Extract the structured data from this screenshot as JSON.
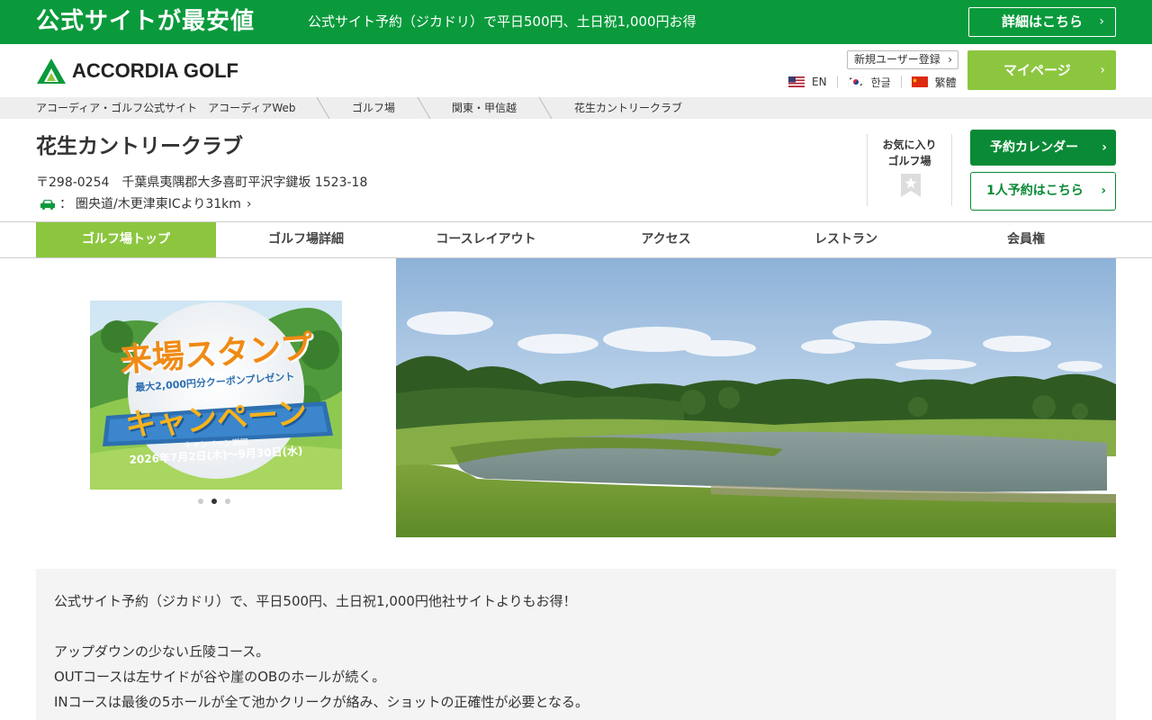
{
  "promo": {
    "title": "公式サイトが最安値",
    "text": "公式サイト予約（ジカドリ）で平日500円、土日祝1,000円お得",
    "detail_button": "詳細はこちら"
  },
  "header": {
    "logo_text": "ACCORDIA GOLF",
    "register_button": "新規ユーザー登録",
    "mypage_button": "マイページ",
    "languages": [
      {
        "label": "EN",
        "flag": "us-flag-icon"
      },
      {
        "label": "한글",
        "flag": "kr-flag-icon"
      },
      {
        "label": "繁體",
        "flag": "cn-flag-icon"
      }
    ]
  },
  "breadcrumb": [
    "アコーディア・ゴルフ公式サイト　アコーディアWeb",
    "ゴルフ場",
    "関東・甲信越",
    "花生カントリークラブ"
  ],
  "club": {
    "name": "花生カントリークラブ",
    "address": "〒298-0254　千葉県夷隅郡大多喜町平沢字鍵坂 1523-18",
    "access_prefix": "：",
    "access": "圏央道/木更津東ICより31km",
    "favorite_label_1": "お気に入り",
    "favorite_label_2": "ゴルフ場",
    "reserve_button": "予約カレンダー",
    "solo_button": "1人予約はこちら"
  },
  "tabs": [
    {
      "label": "ゴルフ場トップ",
      "active": true
    },
    {
      "label": "ゴルフ場詳細",
      "active": false
    },
    {
      "label": "コースレイアウト",
      "active": false
    },
    {
      "label": "アクセス",
      "active": false
    },
    {
      "label": "レストラン",
      "active": false
    },
    {
      "label": "会員権",
      "active": false
    }
  ],
  "campaign": {
    "title_1": "来場スタンプ",
    "subtitle": "最大2,000円分クーポンプレゼント",
    "title_2": "キャンペーン",
    "period_label": "キャンペーン期間",
    "period": "2026年7月2日(木)～9月30日(水)",
    "slides": 3,
    "active_slide": 2
  },
  "description": {
    "line1": "公式サイト予約（ジカドリ）で、平日500円、土日祝1,000円他社サイトよりもお得！",
    "line2": "アップダウンの少ない丘陵コース。",
    "line3": "OUTコースは左サイドが谷や崖のOBのホールが続く。",
    "line4": "INコースは最後の5ホールが全て池かクリークが絡み、ショットの正確性が必要となる。"
  },
  "colors": {
    "brand_green": "#0a9a3c",
    "accent_lime": "#8cc63f",
    "button_green": "#0a8a36"
  }
}
